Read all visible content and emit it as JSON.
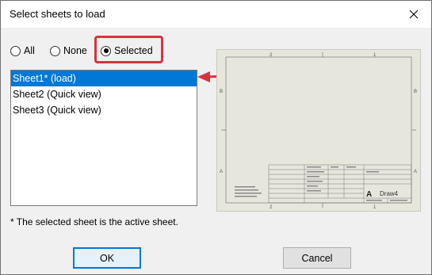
{
  "window": {
    "title": "Select sheets to load"
  },
  "filter": {
    "options": [
      {
        "label": "All",
        "checked": false
      },
      {
        "label": "None",
        "checked": false
      },
      {
        "label": "Selected",
        "checked": true
      }
    ]
  },
  "sheets": [
    {
      "label": "Sheet1* (load)",
      "selected": true
    },
    {
      "label": "Sheet2 (Quick view)",
      "selected": false
    },
    {
      "label": "Sheet3 (Quick view)",
      "selected": false
    }
  ],
  "preview": {
    "zone_top_left": "2",
    "zone_top_right": "1",
    "zone_bottom_left": "2",
    "zone_bottom_right": "1",
    "row_b_left": "B",
    "row_b_right": "B",
    "row_a_left": "A",
    "row_a_right": "A",
    "size_letter": "A",
    "drawing_name": "Draw4"
  },
  "footnote": "* The selected sheet is the active sheet.",
  "buttons": {
    "ok": "OK",
    "cancel": "Cancel"
  },
  "colors": {
    "selection": "#0078d7",
    "callout": "#d6333f"
  }
}
